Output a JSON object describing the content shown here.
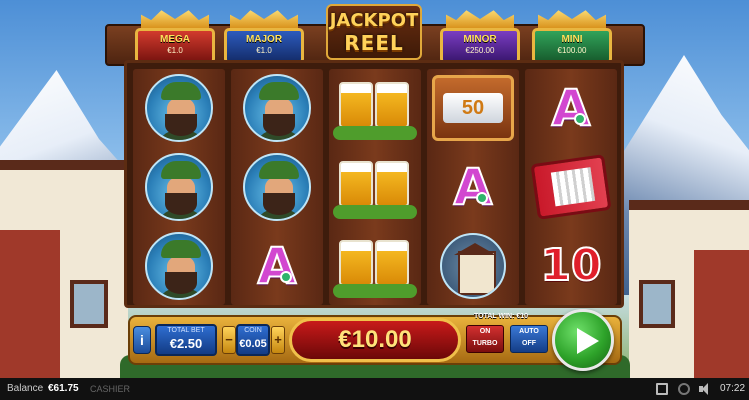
{
  "jackpots": [
    {
      "name": "MEGA",
      "value": "€1.0"
    },
    {
      "name": "MAJOR",
      "value": "€1.0"
    },
    {
      "name": "MINOR",
      "value": "€250.00"
    },
    {
      "name": "MINI",
      "value": "€100.00"
    }
  ],
  "logo": {
    "line1": "JACKPOT",
    "line2": "REEL"
  },
  "reels": [
    [
      "woodsman",
      "woodsman",
      "woodsman"
    ],
    [
      "woodsman",
      "woodsman",
      "A"
    ],
    [
      "beer",
      "beer",
      "beer"
    ],
    [
      "coin-50",
      "A",
      "house"
    ],
    [
      "A",
      "accordion",
      "10"
    ]
  ],
  "symbols": {
    "a_label": "A",
    "ten_label": "10",
    "coin_label": "50"
  },
  "controls": {
    "info_label": "i",
    "total_bet_caption": "TOTAL BET",
    "total_bet_value": "€2.50",
    "coin_caption": "COIN",
    "coin_value": "€0.05",
    "minus_label": "−",
    "plus_label": "+",
    "win_display": "€10.00",
    "total_win_label": "TOTAL WIN: €10",
    "turbo_state": "ON",
    "turbo_label": "TURBO",
    "auto_label": "AUTO",
    "auto_state": "OFF"
  },
  "status_bar": {
    "balance_label": "Balance",
    "balance_value": "€61.75",
    "cashier_label": "CASHIER",
    "clock": "07:22"
  },
  "icons": [
    "info-icon",
    "play-icon",
    "fullscreen-icon",
    "history-icon",
    "sound-icon"
  ],
  "colors": {
    "win_red": "#c81a1a",
    "spin_green": "#2ea32a",
    "gold": "#e9b23c"
  }
}
